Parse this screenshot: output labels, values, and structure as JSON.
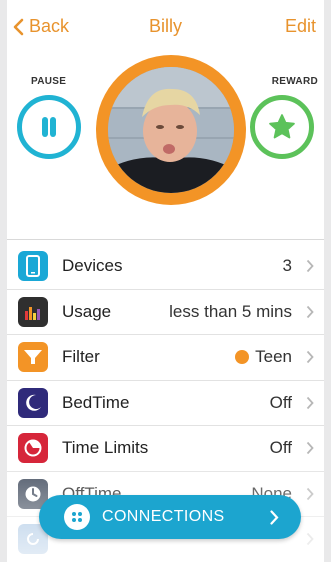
{
  "nav": {
    "back_label": "Back",
    "title": "Billy",
    "edit_label": "Edit"
  },
  "hero": {
    "pause_label": "PAUSE",
    "reward_label": "REWARD"
  },
  "colors": {
    "accent": "#e8932d",
    "pause": "#20b3d3",
    "reward": "#5cc25a",
    "ring": "#f39426",
    "connections": "#1ca5cf"
  },
  "rows": [
    {
      "label": "Devices",
      "value": "3",
      "icon": "device-icon",
      "color": "#1aa8d6"
    },
    {
      "label": "Usage",
      "value": "less than 5 mins",
      "icon": "usage-chart-icon",
      "color": "#2f2f2f"
    },
    {
      "label": "Filter",
      "value": "Teen",
      "icon": "filter-icon",
      "color": "#f39426"
    },
    {
      "label": "BedTime",
      "value": "Off",
      "icon": "moon-icon",
      "color": "#2f2a7a"
    },
    {
      "label": "Time Limits",
      "value": "Off",
      "icon": "time-limits-icon",
      "color": "#d6263a"
    },
    {
      "label": "OffTime",
      "value": "None",
      "icon": "clock-icon",
      "color": "#3f4a5c"
    }
  ],
  "connections": {
    "label": "CONNECTIONS",
    "icon": "connections-icon"
  }
}
